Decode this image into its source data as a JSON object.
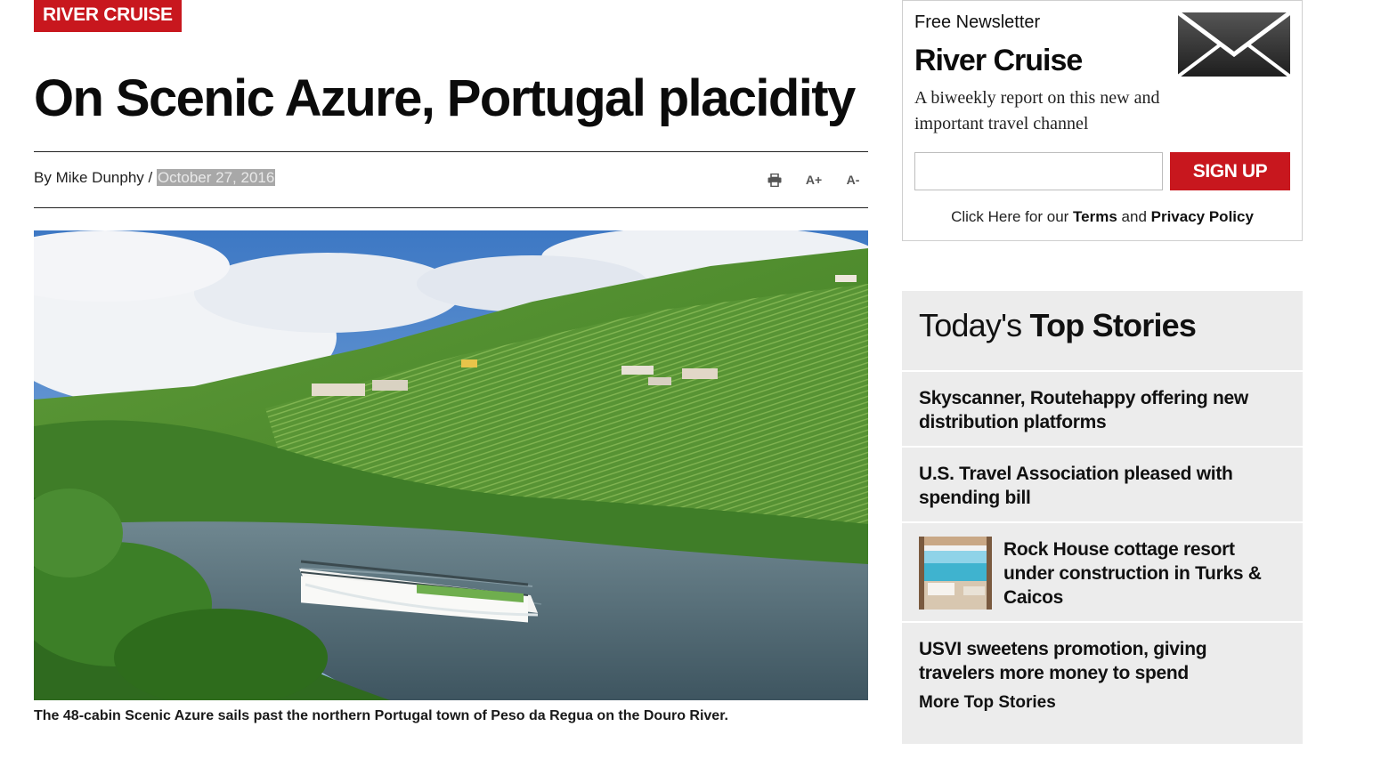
{
  "article": {
    "category": "RIVER CRUISE",
    "headline": "On Scenic Azure, Portugal placidity",
    "byline_prefix": "By ",
    "author": "Mike Dunphy",
    "byline_separator": " / ",
    "date": "October 27, 2016",
    "tools": {
      "print_icon": "print-icon",
      "increase_font": "A+",
      "decrease_font": "A-"
    },
    "caption": "The 48-cabin Scenic Azure sails past the northern Portugal town of Peso da Regua on the Douro River."
  },
  "newsletter": {
    "kicker": "Free Newsletter",
    "title": "River Cruise",
    "description": "A biweekly report on this new and important travel channel",
    "email_value": "",
    "signup_label": "SIGN UP",
    "legal_prefix": "Click Here for our ",
    "terms_label": "Terms",
    "legal_and": " and ",
    "privacy_label": "Privacy Policy",
    "icon": "envelope-icon"
  },
  "top_stories": {
    "header_light": "Today's ",
    "header_bold": "Top Stories",
    "items": [
      {
        "title": "Skyscanner, Routehappy offering new distribution platforms"
      },
      {
        "title": "U.S. Travel Association pleased with spending bill"
      },
      {
        "title": "Rock House cottage resort under construction in Turks & Caicos"
      },
      {
        "title": "USVI sweetens promotion, giving travelers more money to spend"
      }
    ],
    "more_label": "More Top Stories"
  },
  "colors": {
    "brand_red": "#c8171e",
    "sidebar_bg": "#ececec"
  }
}
